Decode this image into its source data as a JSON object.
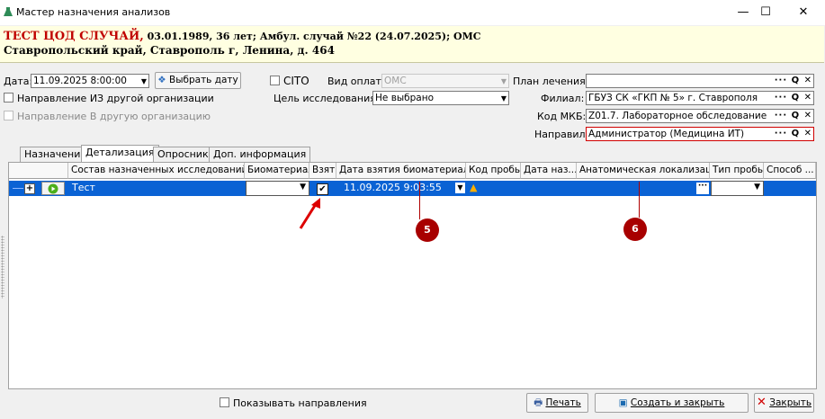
{
  "window": {
    "title": "Мастер назначения анализов",
    "minimize": "—",
    "maximize": "☐",
    "close": "✕"
  },
  "patient": {
    "name": "ТЕСТ ЦОД СЛУЧАЙ,",
    "details": " 03.01.1989, 36 лет; Амбул. случай №22 (24.07.2025); ОМС",
    "address": "Ставропольский край, Ставрополь г, Ленина, д. 464"
  },
  "form": {
    "date_label": "Дата:",
    "date_value": "11.09.2025 8:00:00",
    "choose_date": "Выбрать дату",
    "cito": "CITO",
    "payment_label": "Вид оплаты:",
    "payment_value": "ОМС",
    "plan_label": "План лечения:",
    "plan_value": "",
    "from_other_org": "Направление ИЗ другой организации",
    "purpose_label": "Цель исследования:",
    "purpose_value": "Не выбрано",
    "branch_label": "Филиал:",
    "branch_value": "ГБУЗ СК «ГКП № 5» г. Ставрополя",
    "to_other_org": "Направление В другую организацию",
    "mkb_label": "Код МКБ:",
    "mkb_value": "Z01.7. Лабораторное обследование",
    "sender_label": "Направил:",
    "sender_value": "Администратор (Медицина ИТ)",
    "field_buttons": "··· Q ✕"
  },
  "tabs": [
    "Назначения",
    "Детализация",
    "Опросник",
    "Доп. информация"
  ],
  "grid": {
    "columns": [
      "Состав назначенных исследований",
      "Биоматериал",
      "Взят",
      "Дата взятия биоматериала",
      "Код пробы",
      "Дата наз...",
      "Анатомическая локализация",
      "Тип пробы",
      "Способ ..."
    ],
    "row": {
      "name": "Тест",
      "biomaterial": "",
      "taken": true,
      "date_taken": "11.09.2025 9:03:55",
      "sample_code": "",
      "date_assigned": "",
      "anatomic": "",
      "sample_type": "",
      "method": ""
    }
  },
  "annotations": {
    "badge5": "5",
    "badge6": "6"
  },
  "footer": {
    "show_directions": "Показывать направления",
    "print": "Печать",
    "create_close": "Создать и закрыть",
    "close": "Закрыть"
  }
}
